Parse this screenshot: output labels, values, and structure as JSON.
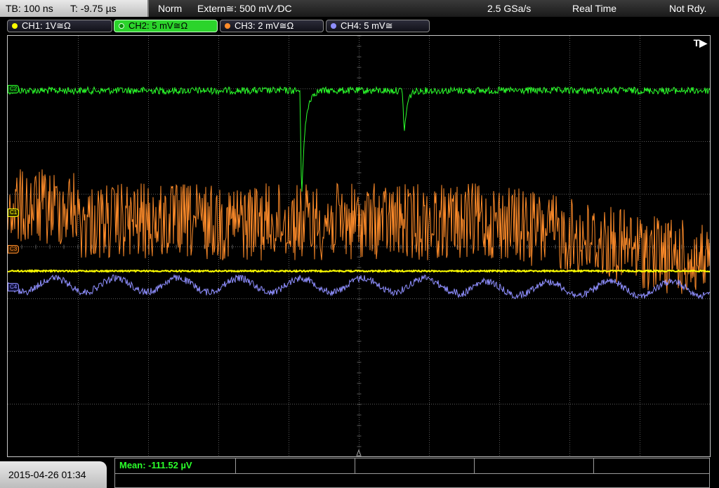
{
  "status": {
    "timebase": "TB: 100 ns",
    "trigger_offset": "T: -9.75 µs",
    "acq_mode": "Norm",
    "trigger": "Extern≅: 500 mV ∕DC",
    "sample_rate": "2.5 GSa/s",
    "mode": "Real Time",
    "state": "Not Rdy."
  },
  "channels": [
    {
      "label": "CH1: 1V≅Ω",
      "color": "#ffff00",
      "active": false
    },
    {
      "label": "CH2: 5 mV≅Ω",
      "color": "#2bff2b",
      "active": true
    },
    {
      "label": "CH3: 2 mV≅Ω",
      "color": "#ff8c2a",
      "active": false
    },
    {
      "label": "CH4: 5 mV≅",
      "color": "#8f8fff",
      "active": false
    }
  ],
  "screen": {
    "trigger_tag": "T▶",
    "markers": {
      "c2": "C2",
      "c1": "C1",
      "c3": "C3",
      "c4": "C4"
    }
  },
  "footer": {
    "datetime": "2015-04-26 01:34",
    "measurement": "Mean: -111.52 µV"
  },
  "colors": {
    "ch1": "#ffff00",
    "ch2": "#2bff2b",
    "ch3": "#ff8c2a",
    "ch4": "#8f8fff",
    "grid": "#5a5a5a"
  }
}
